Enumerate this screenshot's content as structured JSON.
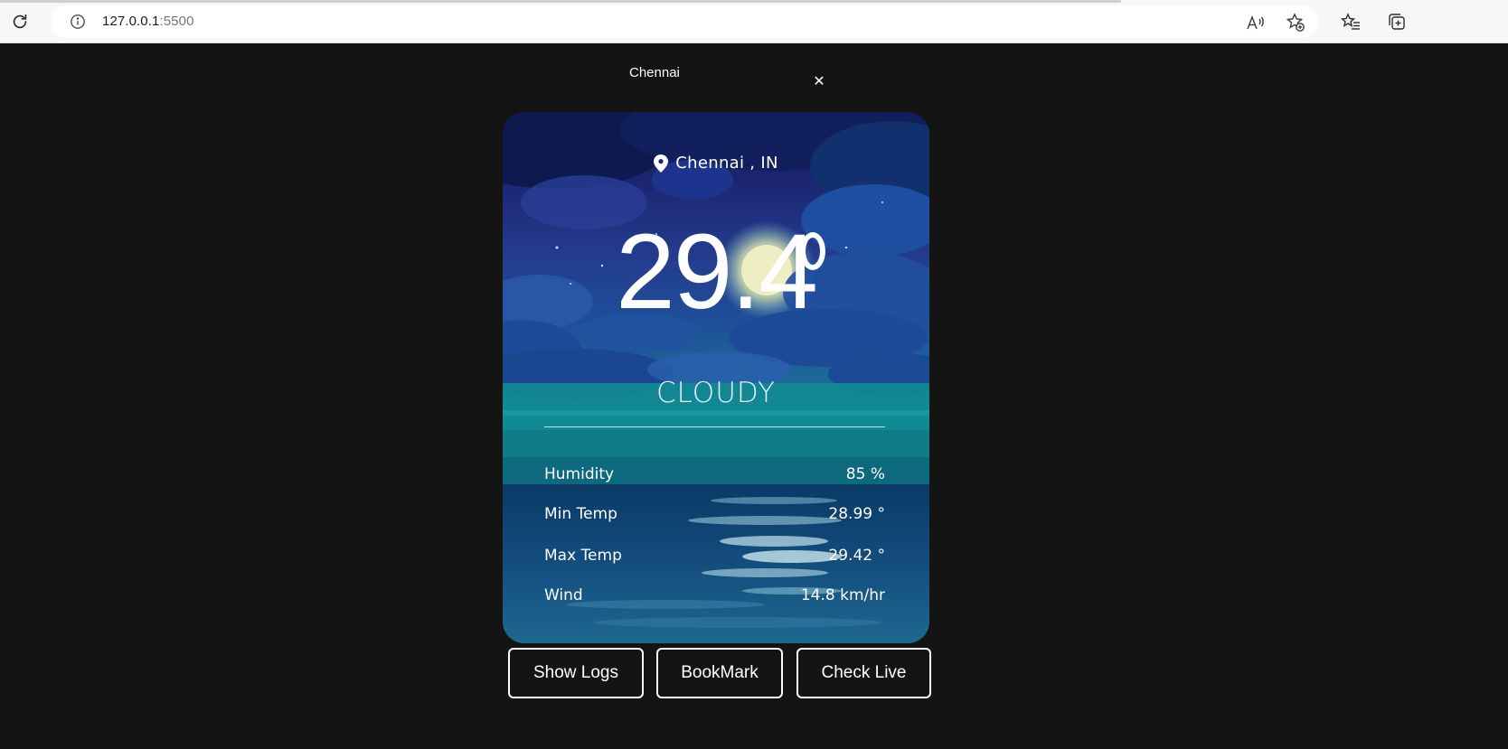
{
  "browser": {
    "url_host": "127.0.0.1",
    "url_port": ":5500"
  },
  "header": {
    "city_label": "Chennai",
    "close_symbol": "✕"
  },
  "weather": {
    "location": "Chennai , IN",
    "temperature": "29.4",
    "condition": "CLOUDY",
    "stats": [
      {
        "label": "Humidity",
        "value": "85 %"
      },
      {
        "label": "Min Temp",
        "value": "28.99 °"
      },
      {
        "label": "Max Temp",
        "value": "29.42 °"
      },
      {
        "label": "Wind",
        "value": "14.8 km/hr"
      }
    ]
  },
  "actions": {
    "show_logs": "Show Logs",
    "bookmark": "BookMark",
    "check_live": "Check Live"
  },
  "icons": {
    "reload": "reload-icon",
    "info": "info-icon",
    "read_aloud": "read-aloud-icon",
    "add_favorite": "add-favorite-icon",
    "favorites": "favorites-icon",
    "collections": "collections-icon",
    "location_pin": "location-pin-icon"
  },
  "colors": {
    "page_background": "#141414",
    "card_top": "#0e1b52",
    "card_sea": "#148c94",
    "text": "#ffffff"
  }
}
